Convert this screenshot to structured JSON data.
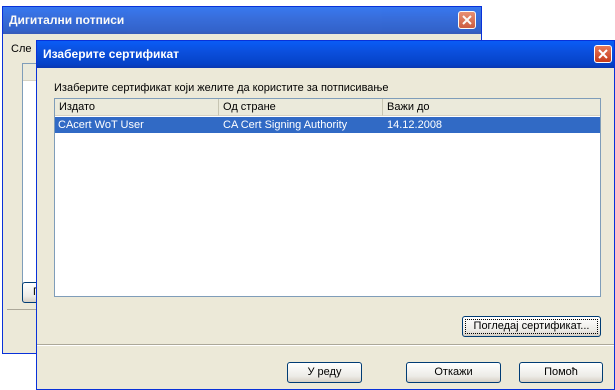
{
  "back_dialog": {
    "title": "Дигитални потписи",
    "label_partial": "Сле",
    "button_partial": "По"
  },
  "dialog": {
    "title": "Изаберите сертификат",
    "instruction": "Изаберите сертификат који желите да користите за потписивање",
    "columns": [
      "Издато",
      "Од стране",
      "Важи до"
    ],
    "rows": [
      {
        "issued_to": "CAcert WoT User",
        "issued_by": "CA Cert Signing Authority",
        "valid_until": "14.12.2008",
        "selected": true
      }
    ],
    "view_certificate_label": "Погледај сертификат...",
    "ok_label": "У реду",
    "cancel_label": "Откажи",
    "help_label": "Помоћ"
  }
}
